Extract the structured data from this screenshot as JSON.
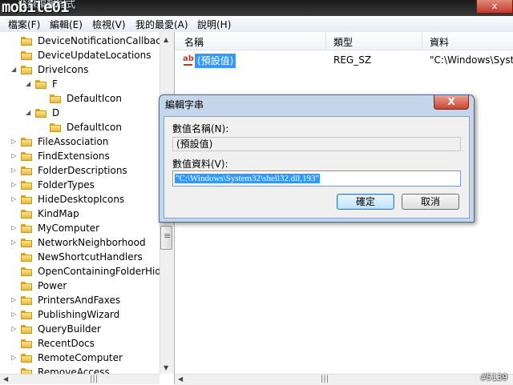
{
  "titlebar": {
    "logo": "mobile01",
    "title": "登錄編輯程式",
    "close": "x"
  },
  "menu": [
    "檔案(F)",
    "編輯(E)",
    "檢視(V)",
    "我的最愛(A)",
    "說明(H)"
  ],
  "tree": [
    {
      "label": "DeviceNotificationCallback",
      "indent": 0,
      "exp": ""
    },
    {
      "label": "DeviceUpdateLocations",
      "indent": 0,
      "exp": ""
    },
    {
      "label": "DriveIcons",
      "indent": 0,
      "exp": "open"
    },
    {
      "label": "F",
      "indent": 1,
      "exp": "open"
    },
    {
      "label": "DefaultIcon",
      "indent": 2,
      "exp": ""
    },
    {
      "label": "D",
      "indent": 1,
      "exp": "open"
    },
    {
      "label": "DefaultIcon",
      "indent": 2,
      "exp": ""
    },
    {
      "label": "FileAssociation",
      "indent": 0,
      "exp": "closed"
    },
    {
      "label": "FindExtensions",
      "indent": 0,
      "exp": "closed"
    },
    {
      "label": "FolderDescriptions",
      "indent": 0,
      "exp": "closed"
    },
    {
      "label": "FolderTypes",
      "indent": 0,
      "exp": "closed"
    },
    {
      "label": "HideDesktopIcons",
      "indent": 0,
      "exp": "closed"
    },
    {
      "label": "KindMap",
      "indent": 0,
      "exp": ""
    },
    {
      "label": "MyComputer",
      "indent": 0,
      "exp": "closed"
    },
    {
      "label": "NetworkNeighborhood",
      "indent": 0,
      "exp": "closed"
    },
    {
      "label": "NewShortcutHandlers",
      "indent": 0,
      "exp": ""
    },
    {
      "label": "OpenContainingFolderHid",
      "indent": 0,
      "exp": ""
    },
    {
      "label": "Power",
      "indent": 0,
      "exp": ""
    },
    {
      "label": "PrintersAndFaxes",
      "indent": 0,
      "exp": "closed"
    },
    {
      "label": "PublishingWizard",
      "indent": 0,
      "exp": "closed"
    },
    {
      "label": "QueryBuilder",
      "indent": 0,
      "exp": "closed"
    },
    {
      "label": "RecentDocs",
      "indent": 0,
      "exp": ""
    },
    {
      "label": "RemoteComputer",
      "indent": 0,
      "exp": "closed"
    },
    {
      "label": "RemoveAccess",
      "indent": 0,
      "exp": ""
    }
  ],
  "list": {
    "columns": [
      "名稱",
      "類型",
      "資料"
    ],
    "row": {
      "icon": "ab",
      "name": "(預設值)",
      "type": "REG_SZ",
      "data": "\"C:\\Windows\\Syste"
    }
  },
  "dialog": {
    "title": "編輯字串",
    "close": "X",
    "name_label": "數值名稱(N):",
    "name_value": "(預設值)",
    "data_label": "數值資料(V):",
    "data_value": "\"C:\\Windows\\System32\\shell32.dll,193\"",
    "ok": "確定",
    "cancel": "取消"
  },
  "watermark": "#5139"
}
